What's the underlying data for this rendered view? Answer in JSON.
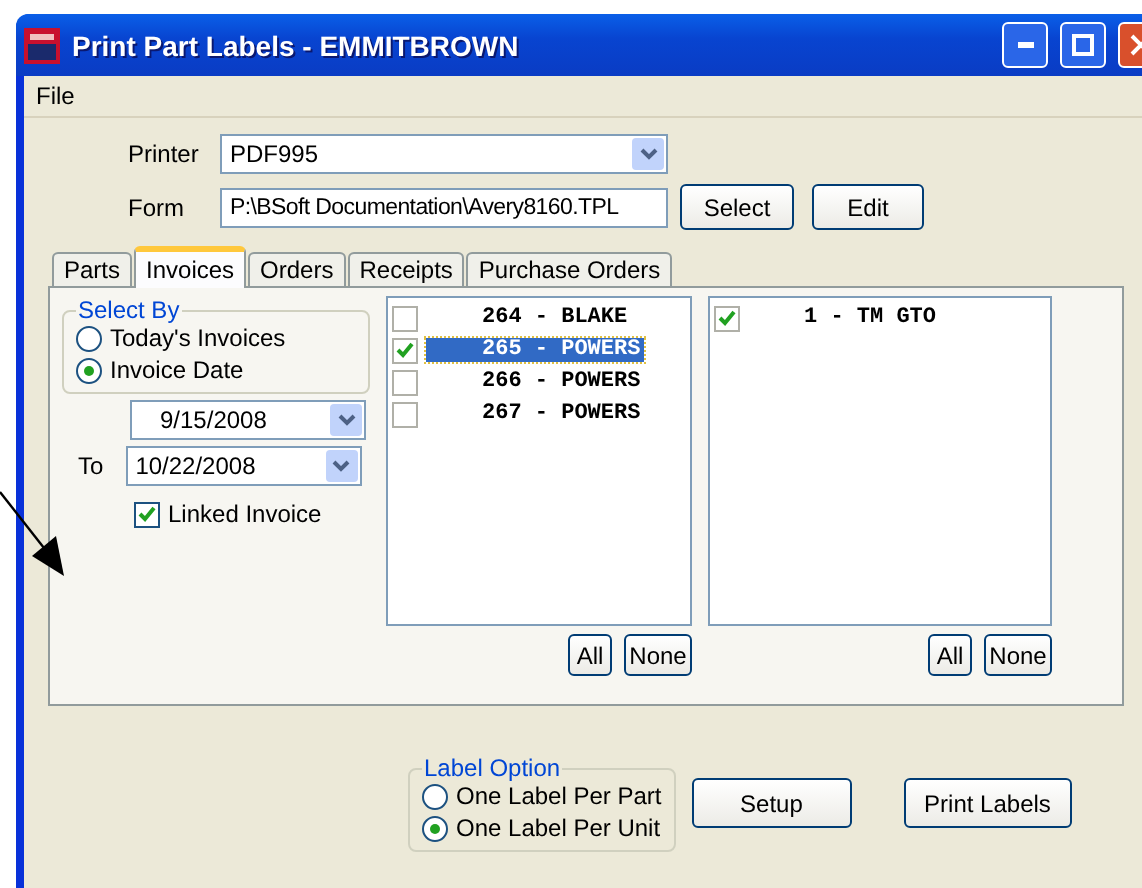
{
  "window": {
    "title": "Print Part Labels - EMMITBROWN"
  },
  "menu": [
    "File"
  ],
  "printer": {
    "label": "Printer",
    "value": "PDF995"
  },
  "form": {
    "label": "Form",
    "value": "P:\\BSoft Documentation\\Avery8160.TPL",
    "buttons": [
      "Select",
      "Edit"
    ]
  },
  "tabs": [
    {
      "label": "Parts",
      "selected": false
    },
    {
      "label": "Invoices",
      "selected": true
    },
    {
      "label": "Orders",
      "selected": false
    },
    {
      "label": "Receipts",
      "selected": false
    },
    {
      "label": "Purchase Orders",
      "selected": false
    }
  ],
  "select_by": {
    "title": "Select By",
    "options": [
      {
        "label": "Today's Invoices",
        "selected": false
      },
      {
        "label": "Invoice Date",
        "selected": true
      }
    ]
  },
  "date_from": {
    "value": "9/15/2008"
  },
  "date_to": {
    "label": "To",
    "value": "10/22/2008"
  },
  "linked_invoice": {
    "label": "Linked Invoice",
    "checked": true
  },
  "invoice_list": {
    "items": [
      {
        "text": "264 - BLAKE",
        "checked": false,
        "selected": false
      },
      {
        "text": "265 - POWERS",
        "checked": true,
        "selected": true
      },
      {
        "text": "266 - POWERS",
        "checked": false,
        "selected": false
      },
      {
        "text": "267 - POWERS",
        "checked": false,
        "selected": false
      }
    ],
    "buttons": [
      "All",
      "None"
    ]
  },
  "part_list": {
    "items": [
      {
        "text": "1 - TM GTO",
        "checked": true,
        "selected": false
      }
    ],
    "buttons": [
      "All",
      "None"
    ]
  },
  "label_option": {
    "title": "Label Option",
    "options": [
      {
        "label": "One Label Per Part",
        "selected": false
      },
      {
        "label": "One Label Per Unit",
        "selected": true
      }
    ]
  },
  "buttons": [
    "Setup",
    "Print Labels"
  ]
}
